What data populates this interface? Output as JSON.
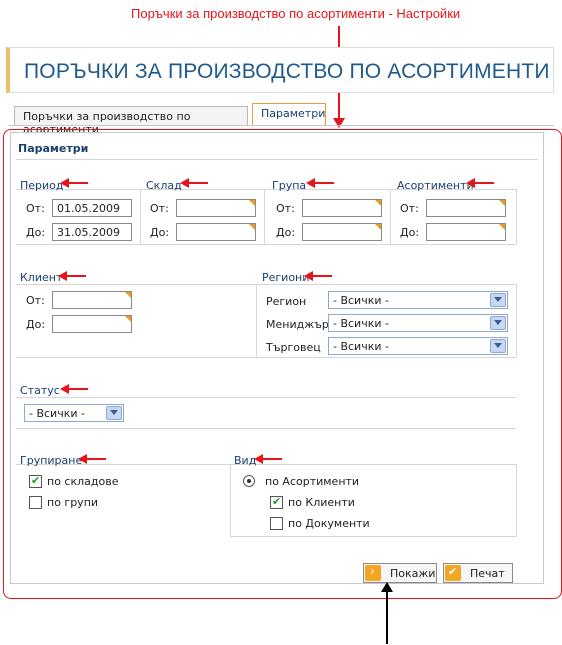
{
  "annotation_top": "Поръчки за производство по асортименти - Настройки",
  "page_title": "ПОРЪЧКИ ЗА ПРОИЗВОДСТВО ПО АСОРТИМЕНТИ",
  "tabs": [
    {
      "label": "Поръчки за производство по асортименти",
      "active": false
    },
    {
      "label": "Параметри",
      "active": true
    }
  ],
  "panel_title": "Параметри",
  "period": {
    "label": "Период",
    "from_label": "От:",
    "to_label": "До:",
    "from": "01.05.2009",
    "to": "31.05.2009"
  },
  "warehouse": {
    "label": "Склад",
    "from_label": "От:",
    "to_label": "До:",
    "from": "",
    "to": ""
  },
  "group": {
    "label": "Група",
    "from_label": "От:",
    "to_label": "До:",
    "from": "",
    "to": ""
  },
  "assortments": {
    "label": "Асортименти",
    "from_label": "От:",
    "to_label": "До:",
    "from": "",
    "to": ""
  },
  "client": {
    "label": "Клиент",
    "from_label": "От:",
    "to_label": "До:",
    "from": "",
    "to": ""
  },
  "regions": {
    "label": "Региони",
    "region_label": "Регион",
    "region_value": "- Всички -",
    "manager_label": "Мениджър",
    "manager_value": "- Всички -",
    "trader_label": "Търговец",
    "trader_value": "- Всички -"
  },
  "status": {
    "label": "Статус",
    "value": "- Всички -"
  },
  "grouping": {
    "label": "Групиране",
    "options": [
      {
        "label": "по складове",
        "checked": true
      },
      {
        "label": "по групи",
        "checked": false
      }
    ]
  },
  "view": {
    "label": "Вид",
    "radio_label": "по Асортименти",
    "radio_selected": true,
    "options": [
      {
        "label": "по Клиенти",
        "checked": true
      },
      {
        "label": "по Документи",
        "checked": false
      }
    ]
  },
  "buttons": {
    "show": "Покажи",
    "print": "Печат"
  },
  "colors": {
    "annotation": "#e8141c",
    "title": "#1f5a8a",
    "accent": "#f5a623",
    "label": "#1a3f70"
  }
}
